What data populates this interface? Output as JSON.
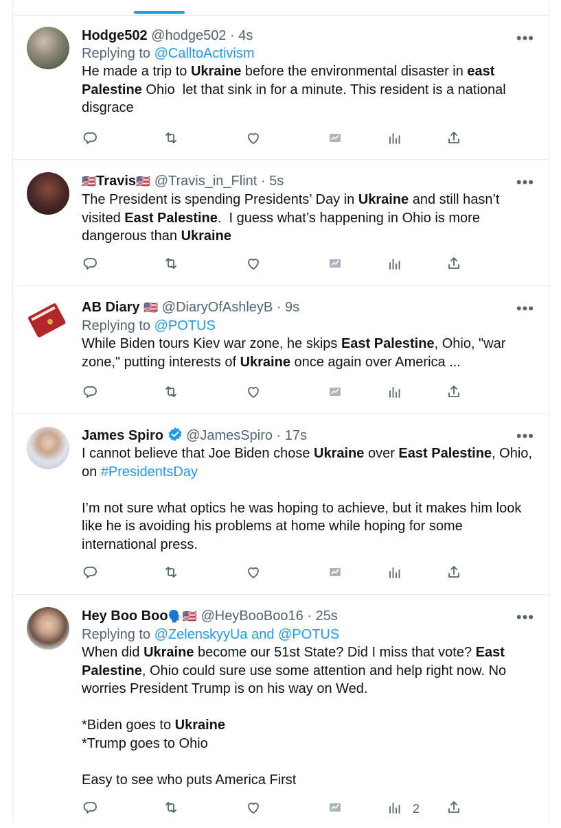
{
  "tweets": [
    {
      "name": "Hodge502",
      "handle": "@hodge502",
      "time": "4s",
      "reply_prefix": "Replying to ",
      "reply_to": "@CalltoActivism",
      "text_parts": [
        {
          "t": "He made a trip to "
        },
        {
          "b": "Ukraine"
        },
        {
          "t": " before the environmental disaster in "
        },
        {
          "b": "east Palestine"
        },
        {
          "t": " Ohio  let that sink in for a minute. This resident is a national disgrace"
        }
      ]
    },
    {
      "name": "Travis",
      "name_flag_left": "🇺🇸",
      "name_flag_right": "🇺🇸",
      "handle": "@Travis_in_Flint",
      "time": "5s",
      "text_parts": [
        {
          "t": "The President is spending Presidents’ Day in "
        },
        {
          "b": "Ukraine"
        },
        {
          "t": " and still hasn’t visited "
        },
        {
          "b": "East Palestine"
        },
        {
          "t": ".  I guess what’s happening in Ohio is more dangerous than "
        },
        {
          "b": "Ukraine"
        }
      ]
    },
    {
      "name": "AB Diary",
      "name_flag_right": "🇺🇸",
      "handle": "@DiaryOfAshleyB",
      "time": "9s",
      "reply_prefix": "Replying to ",
      "reply_to": "@POTUS",
      "text_parts": [
        {
          "t": "While Biden tours Kiev war zone, he skips "
        },
        {
          "b": "East Palestine"
        },
        {
          "t": ", Ohio, \"war zone,\" putting interests of "
        },
        {
          "b": "Ukraine"
        },
        {
          "t": " once again over America ..."
        }
      ]
    },
    {
      "name": "James Spiro",
      "verified": true,
      "handle": "@JamesSpiro",
      "time": "17s",
      "text_parts": [
        {
          "t": "I cannot believe that Joe Biden chose "
        },
        {
          "b": "Ukraine"
        },
        {
          "t": " over "
        },
        {
          "b": "East Palestine"
        },
        {
          "t": ", Ohio, on "
        },
        {
          "l": "#PresidentsDay"
        },
        {
          "t": "\n\nI’m not sure what optics he was hoping to achieve, but it makes him look like he is avoiding his problems at home while hoping for some international press."
        }
      ]
    },
    {
      "name": "Hey Boo Boo",
      "name_flag_right": "🗣️🇺🇸",
      "handle": "@HeyBooBoo16",
      "time": "25s",
      "reply_prefix": "Replying to ",
      "reply_to": "@ZelenskyyUa and @POTUS",
      "text_parts": [
        {
          "t": "When did "
        },
        {
          "b": "Ukraine"
        },
        {
          "t": " become our 51st State? Did I miss that vote? "
        },
        {
          "b": "East Palestine"
        },
        {
          "t": ", Ohio could sure use some attention and help right now. No worries President Trump is on his way on Wed.\n\n*Biden goes to "
        },
        {
          "b": "Ukraine"
        },
        {
          "t": "\n*Trump goes to Ohio\n\nEasy to see who puts America First"
        }
      ],
      "views": "2"
    }
  ],
  "separator": "·",
  "more_glyph": "•••",
  "icons": [
    "reply-icon",
    "retweet-icon",
    "like-icon",
    "analytics-muted-icon",
    "views-icon",
    "share-icon"
  ],
  "colors": {
    "accent": "#1d9bf0",
    "muted": "#536471",
    "text": "#0f1419",
    "border": "#e6ecf0"
  }
}
